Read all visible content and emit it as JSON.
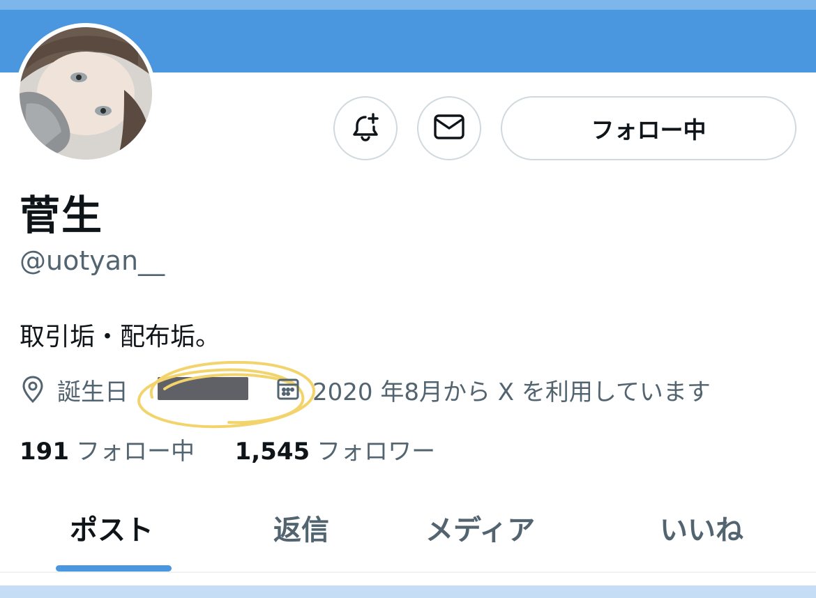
{
  "profile": {
    "display_name": "菅生",
    "handle": "@uotyan__",
    "bio": "取引垢・配布垢。",
    "birthday_label": "誕生日",
    "joined_text": "2020 年8月から X を利用しています"
  },
  "actions": {
    "follow_label": "フォロー中"
  },
  "stats": {
    "following_count": "191",
    "following_label": "フォロー中",
    "followers_count": "1,545",
    "followers_label": "フォロワー"
  },
  "tabs": [
    {
      "label": "ポスト",
      "active": true
    },
    {
      "label": "返信",
      "active": false
    },
    {
      "label": "メディア",
      "active": false
    },
    {
      "label": "いいね",
      "active": false
    }
  ],
  "colors": {
    "banner": "#4a97e0",
    "accent": "#4a97e0",
    "highlight_circle": "#f3d36b",
    "redaction": "#5f6166"
  },
  "icons": [
    "bell-plus-icon",
    "mail-icon",
    "location-pin-icon",
    "calendar-icon"
  ]
}
